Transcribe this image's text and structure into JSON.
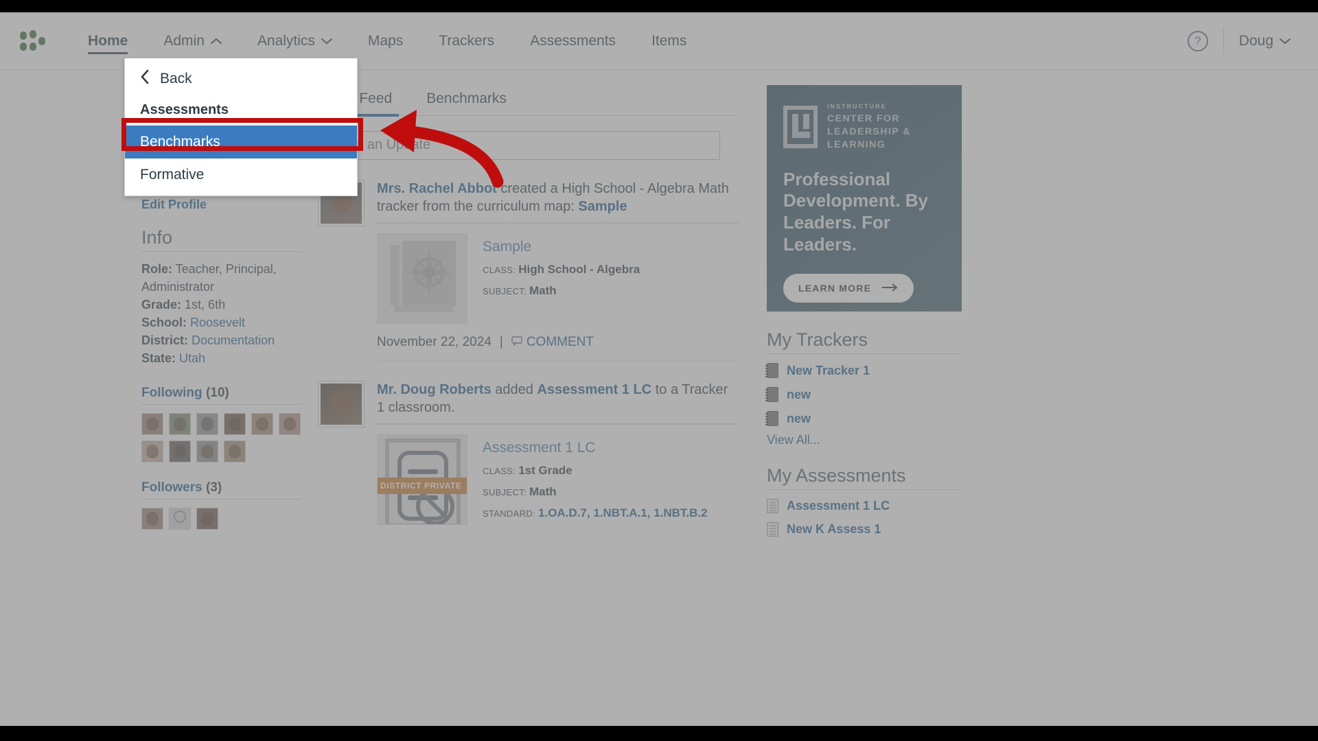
{
  "topnav": {
    "logo_icon": "instructure-mastery-logo",
    "items": [
      {
        "label": "Home",
        "active": true,
        "caret": ""
      },
      {
        "label": "Admin",
        "active": false,
        "caret": "chevron-up-icon"
      },
      {
        "label": "Analytics",
        "active": false,
        "caret": "chevron-down-icon"
      },
      {
        "label": "Maps",
        "active": false,
        "caret": ""
      },
      {
        "label": "Trackers",
        "active": false,
        "caret": ""
      },
      {
        "label": "Assessments",
        "active": false,
        "caret": ""
      },
      {
        "label": "Items",
        "active": false,
        "caret": ""
      }
    ],
    "help_label": "?",
    "help_icon": "question-mark-icon",
    "user_label": "Doug",
    "user_caret_icon": "chevron-down-icon"
  },
  "dropdown": {
    "back_label": "Back",
    "back_icon": "chevron-left-icon",
    "group_header": "Assessments",
    "items": [
      {
        "label": "Benchmarks",
        "selected": true
      },
      {
        "label": "Formative",
        "selected": false
      }
    ]
  },
  "annotation": {
    "highlight_color": "#bf0d0d",
    "arrow_icon": "left-arrow-annotation"
  },
  "profile": {
    "avatar_alt": "user-photo",
    "edit_profile_label": "Edit Profile",
    "info_title": "Info",
    "info": [
      {
        "key": "Role:",
        "value": "Teacher, Principal, Administrator",
        "is_link": false
      },
      {
        "key": "Grade:",
        "value": "1st, 6th",
        "is_link": false
      },
      {
        "key": "School:",
        "value": "Roosevelt",
        "is_link": true
      },
      {
        "key": "District:",
        "value": "Documentation",
        "is_link": true
      },
      {
        "key": "State:",
        "value": "Utah",
        "is_link": true
      }
    ],
    "following_label": "Following",
    "following_count": "(10)",
    "followers_label": "Followers",
    "followers_count": "(3)"
  },
  "feed": {
    "tabs": [
      {
        "label": "News Feed",
        "active": true
      },
      {
        "label": "Benchmarks",
        "active": false
      }
    ],
    "share_placeholder": "Share an Update",
    "share_value": "",
    "posts": [
      {
        "author": "Mrs. Rachel Abbot",
        "text_middle": " created a High School - Algebra Math tracker from the curriculum map: ",
        "link": "Sample",
        "card_title": "Sample",
        "card_icon": "compass-icon",
        "badge": "",
        "meta": [
          {
            "key": "CLASS:",
            "value": "High School - Algebra",
            "is_link": false
          },
          {
            "key": "SUBJECT:",
            "value": "Math",
            "is_link": false
          }
        ],
        "date": "November 22, 2024",
        "separator": "|",
        "comment_label": "COMMENT",
        "comment_icon": "comment-bubble-icon"
      },
      {
        "author": "Mr. Doug Roberts",
        "text_middle": " added ",
        "link": "Assessment 1 LC",
        "text_tail": " to a Tracker 1 classroom.",
        "card_title": "Assessment 1 LC",
        "card_icon": "assessment-blocked-icon",
        "badge": "DISTRICT PRIVATE",
        "meta": [
          {
            "key": "CLASS:",
            "value": "1st Grade",
            "is_link": false
          },
          {
            "key": "SUBJECT:",
            "value": "Math",
            "is_link": false
          },
          {
            "key": "STANDARD:",
            "value": "1.OA.D.7, 1.NBT.A.1, 1.NBT.B.2",
            "is_link": true
          }
        ]
      }
    ]
  },
  "ad": {
    "brand_kicker": "INSTRUCTURE",
    "brand_name": "CENTER FOR LEADERSHIP & LEARNING",
    "logo_icon": "ll-monogram-icon",
    "headline": "Professional Development. By Leaders. For Leaders.",
    "cta_label": "LEARN MORE",
    "cta_icon": "arrow-right-icon"
  },
  "trackers": {
    "title": "My Trackers",
    "items": [
      {
        "label": "New Tracker 1",
        "icon": "notebook-icon"
      },
      {
        "label": "new",
        "icon": "notebook-icon"
      },
      {
        "label": "new",
        "icon": "notebook-icon"
      }
    ],
    "view_all_label": "View All..."
  },
  "assessments": {
    "title": "My Assessments",
    "items": [
      {
        "label": "Assessment 1 LC",
        "icon": "document-icon"
      },
      {
        "label": "New K Assess 1",
        "icon": "document-icon"
      }
    ]
  }
}
